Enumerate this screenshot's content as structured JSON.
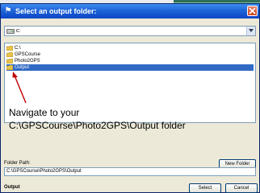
{
  "dialog": {
    "title": "Select an output folder:",
    "drive_value": "c:",
    "tree_items": [
      {
        "label": "C:\\",
        "selected": false
      },
      {
        "label": "GPSCourse",
        "selected": false
      },
      {
        "label": "Photo2GPS",
        "selected": false
      },
      {
        "label": "Output",
        "selected": true
      }
    ],
    "folder_path_label": "Folder Path:",
    "folder_path_value": "C:\\GPSCourse\\Photo2GPS\\Output",
    "new_folder_label": "New Folder",
    "status_text": "Output",
    "select_label": "Select",
    "cancel_label": "Cancel"
  },
  "annotation": {
    "line1": "Navigate to your",
    "line2": "C:\\GPSCourse\\Photo2GPS\\Output folder"
  },
  "colors": {
    "titlebar": "#1f64d8",
    "selection": "#316ac5",
    "annotation_arrow": "#c00000",
    "folder": "#e8c34a"
  },
  "icons": {
    "title": "dialog-icon",
    "close": "close-icon",
    "drive": "drive-icon",
    "combo": "chevron-down-icon",
    "folder": "folder-icon"
  }
}
